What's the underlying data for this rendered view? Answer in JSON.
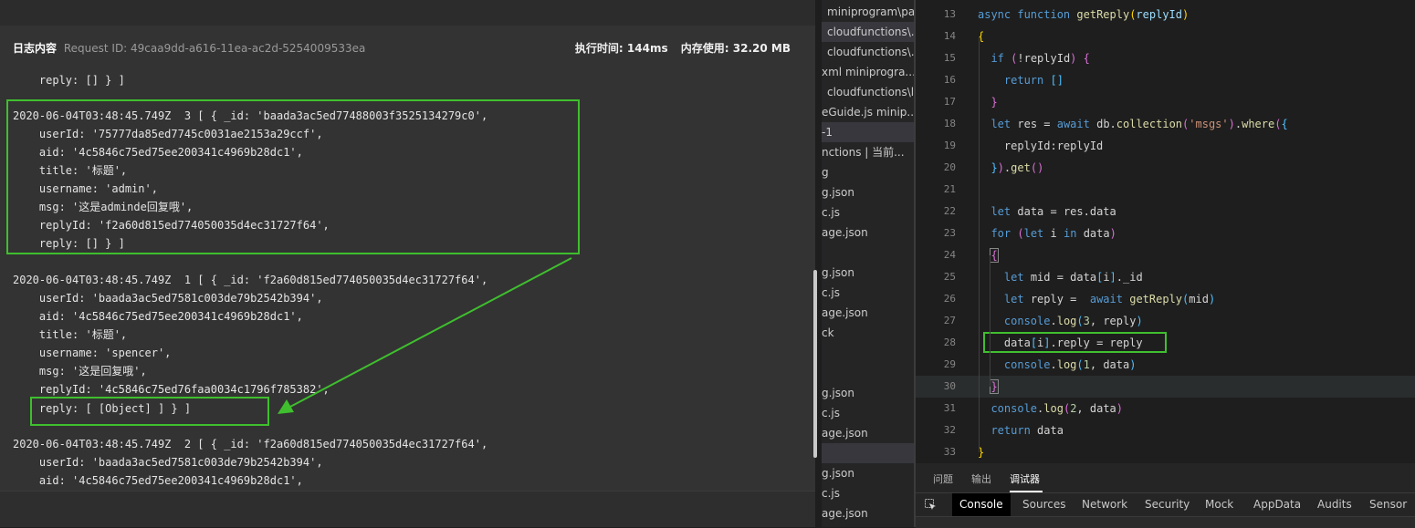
{
  "log": {
    "title": "日志内容",
    "request_id": "Request ID: 49caa9dd-a616-11ea-ac2d-5254009533ea",
    "exec_time": "执行时间: 144ms",
    "memory": "内存使用: 32.20 MB",
    "lines": [
      "    reply: [] } ]",
      "2020-06-04T03:48:45.749Z  3 [ { _id: 'baada3ac5ed77488003f3525134279c0',",
      "    userId: '75777da85ed7745c0031ae2153a29ccf',",
      "    aid: '4c5846c75ed75ee200341c4969b28dc1',",
      "    title: '标题',",
      "    username: 'admin',",
      "    msg: '这是adminde回复哦',",
      "    replyId: 'f2a60d815ed774050035d4ec31727f64',",
      "    reply: [] } ]",
      "2020-06-04T03:48:45.749Z  1 [ { _id: 'f2a60d815ed774050035d4ec31727f64',",
      "    userId: 'baada3ac5ed7581c003de79b2542b394',",
      "    aid: '4c5846c75ed75ee200341c4969b28dc1',",
      "    title: '标题',",
      "    username: 'spencer',",
      "    msg: '这是回复哦',",
      "    replyId: '4c5846c75ed76faa0034c1796f785382',",
      "    reply: [ [Object] ] } ]",
      "2020-06-04T03:48:45.749Z  2 [ { _id: 'f2a60d815ed774050035d4ec31727f64',",
      "    userId: 'baada3ac5ed7581c003de79b2542b394',",
      "    aid: '4c5846c75ed75ee200341c4969b28dc1',"
    ]
  },
  "files": [
    "miniprogram\\pa...",
    "cloudfunctions\\...",
    "cloudfunctions\\...",
    "xml  miniprogra...",
    "cloudfunctions\\l...",
    "eGuide.js  minip...",
    "-1",
    "nctions | 当前...",
    "g",
    "g.json",
    "c.js",
    "age.json",
    "g.json",
    "c.js",
    "age.json",
    "ck",
    "g.json",
    "c.js",
    "age.json",
    "g.json",
    "c.js",
    "age.json"
  ],
  "editor": {
    "line_numbers": [
      "13",
      "14",
      "15",
      "16",
      "17",
      "18",
      "19",
      "20",
      "21",
      "22",
      "23",
      "24",
      "25",
      "26",
      "27",
      "28",
      "29",
      "30",
      "31",
      "32",
      "33"
    ]
  },
  "devtools": {
    "tabs": [
      "问题",
      "输出",
      "调试器"
    ],
    "subtabs": [
      "Console",
      "Sources",
      "Network",
      "Security",
      "Mock",
      "AppData",
      "Audits",
      "Sensor"
    ]
  },
  "colors": {
    "annotation": "#3fbf2e",
    "log_bg": "#333333",
    "editor_bg": "#1e1e1e"
  }
}
